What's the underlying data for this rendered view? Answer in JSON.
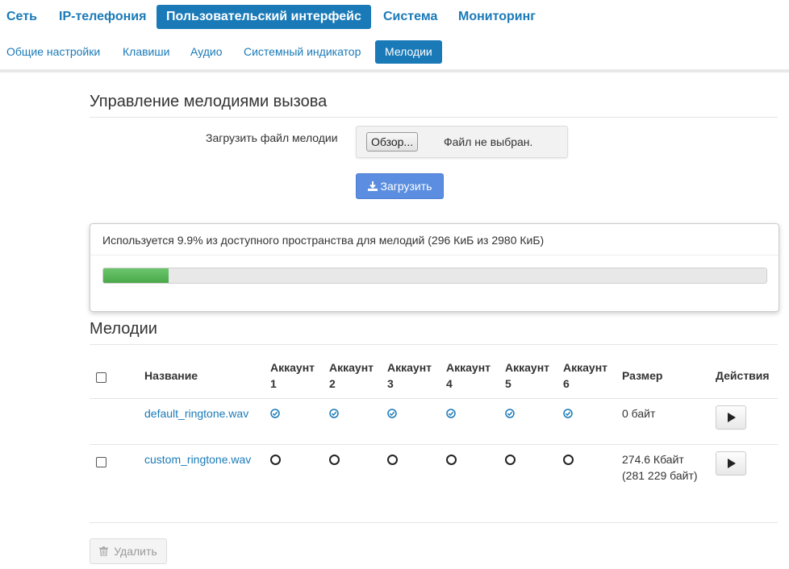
{
  "nav_main": [
    "Сеть",
    "IP-телефония",
    "Пользовательский интерфейс",
    "Система",
    "Мониторинг"
  ],
  "nav_sub": [
    "Общие настройки",
    "Клавиши",
    "Аудио",
    "Системный индикатор",
    "Мелодии"
  ],
  "upload": {
    "title": "Управление мелодиями вызова",
    "label": "Загрузить файл мелодии",
    "browse_label": "Обзор...",
    "file_status": "Файл не выбран.",
    "upload_label": "Загрузить"
  },
  "usage": {
    "text": "Используется 9.9% из доступного пространства для мелодий (296 КиБ из 2980 КиБ)",
    "percent": 9.9
  },
  "ringtones": {
    "title": "Мелодии",
    "headers": {
      "name": "Название",
      "account_word": "Аккаунт",
      "accounts": [
        "1",
        "2",
        "3",
        "4",
        "5",
        "6"
      ],
      "size": "Размер",
      "actions": "Действия"
    },
    "rows": [
      {
        "name": "default_ringtone.wav",
        "size_line1": "0 байт",
        "size_line2": "",
        "selectable": false,
        "accounts_checked": [
          true,
          true,
          true,
          true,
          true,
          true
        ]
      },
      {
        "name": "custom_ringtone.wav",
        "size_line1": "274.6 Кбайт",
        "size_line2": "(281 229 байт)",
        "selectable": true,
        "accounts_checked": [
          false,
          false,
          false,
          false,
          false,
          false
        ]
      }
    ]
  },
  "delete_label": "Удалить",
  "colors": {
    "primary": "#1a7ab8",
    "upload_button": "#5b8ee0",
    "progress_fill": "#5cb85c",
    "check": "#1a7ab8"
  },
  "icons": {
    "upload": "upload-icon",
    "play": "play-icon",
    "trash": "trash-icon",
    "check": "check-circle-icon",
    "circle": "circle-icon"
  }
}
